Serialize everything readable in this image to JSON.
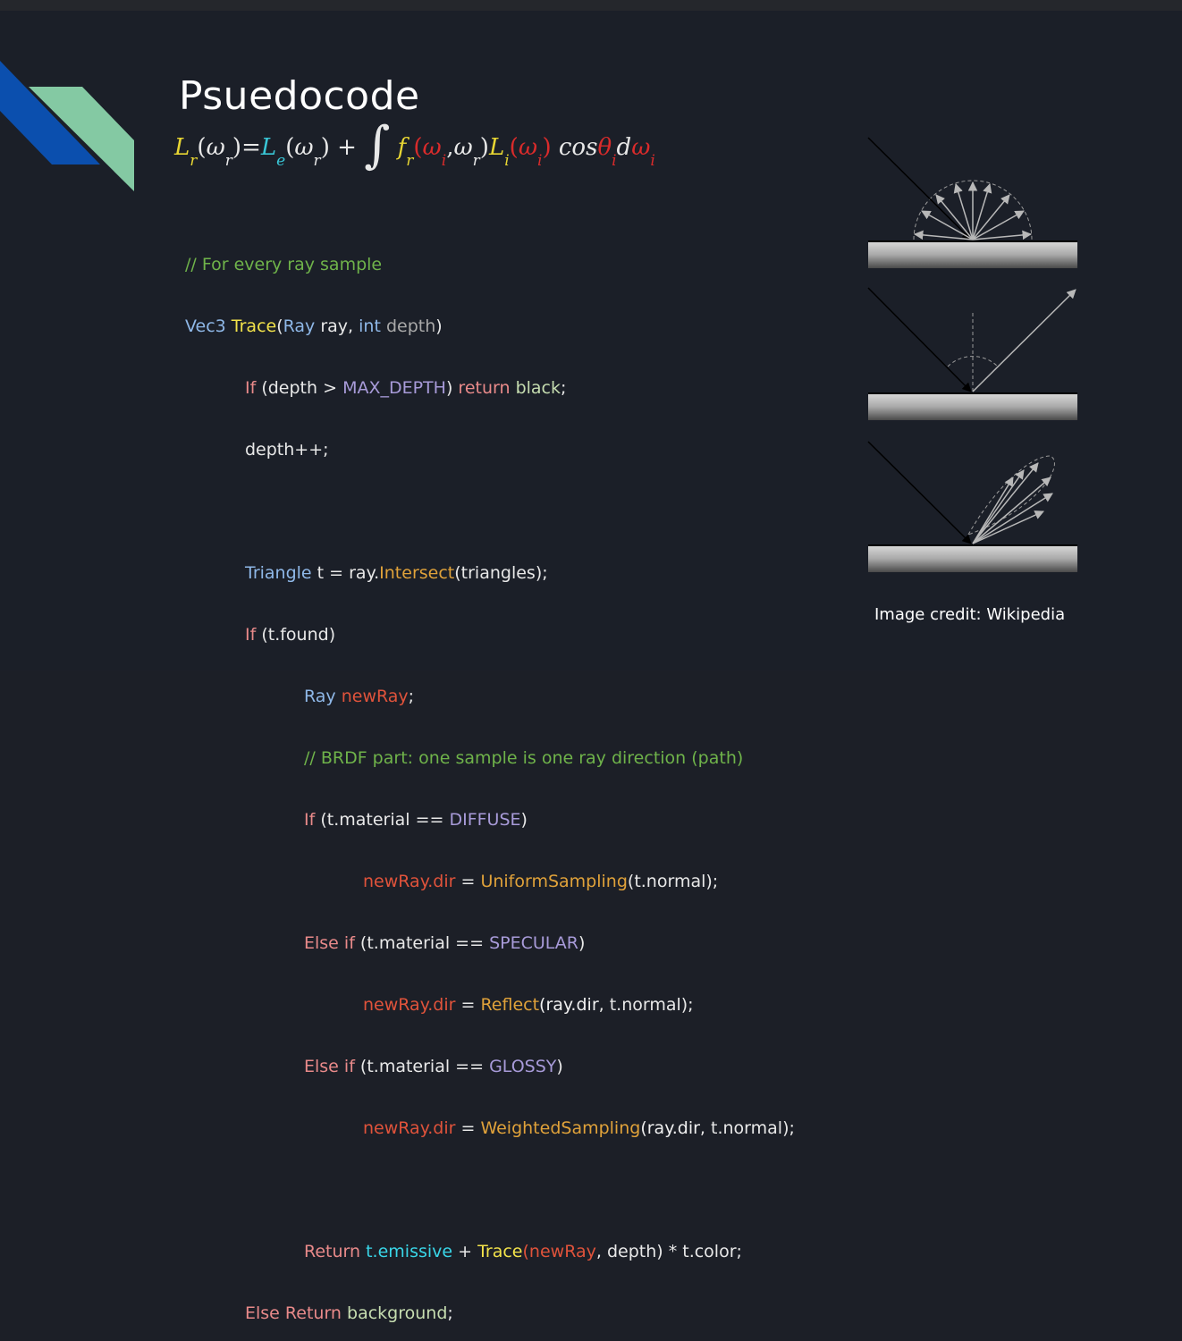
{
  "slide": {
    "title": "Psuedocode",
    "credit": "Image credit: Wikipedia"
  },
  "equation": {
    "L": "L",
    "r": "r",
    "omega": "ω",
    "eq": "=",
    "e": "e",
    "plus": "+",
    "integral": "∫",
    "f": "f",
    "i": "i",
    "comma": ",",
    "cos": "cos",
    "theta": "θ",
    "d": "d",
    "lp": "(",
    "rp": ")"
  },
  "code": {
    "l1": "// For every ray sample",
    "l2": [
      "Vec3",
      " ",
      "Trace",
      "(",
      "Ray",
      " ray, ",
      "int",
      " ",
      "depth",
      ")"
    ],
    "l3": [
      "If",
      " (depth > ",
      "MAX_DEPTH",
      ") ",
      "return",
      " ",
      "black",
      ";"
    ],
    "l4": "depth++;",
    "l6": [
      "Triangle",
      " t = ray.",
      "Intersect",
      "(triangles);"
    ],
    "l7": [
      "If",
      " (t.found)"
    ],
    "l8": [
      "Ray",
      " ",
      "newRay",
      ";"
    ],
    "l9": "// BRDF part: one sample is one ray direction (path)",
    "l10": [
      "If",
      " (t.material == ",
      "DIFFUSE",
      ")"
    ],
    "l11": [
      "newRay.dir",
      " = ",
      "UniformSampling",
      "(t.normal);"
    ],
    "l12": [
      "Else if",
      " (t.material == ",
      "SPECULAR",
      ")"
    ],
    "l13": [
      "newRay.dir",
      " = ",
      "Reflect",
      "(ray.dir",
      ", t.normal);"
    ],
    "l14": [
      "Else if",
      " (t.material == ",
      "GLOSSY",
      ")"
    ],
    "l15": [
      "newRay.dir",
      " = ",
      "WeightedSampling",
      "(ray.dir",
      ", t.normal);"
    ],
    "l17": [
      "Return",
      " ",
      "t.emissive",
      " + ",
      "Trace",
      "(",
      "newRay",
      ", depth) * t.color;"
    ],
    "l18": [
      "Else Return",
      " ",
      "background",
      ";"
    ]
  },
  "colors": {
    "background": "#1b1f28",
    "comment": "#6fb34a",
    "type": "#8fb8e8",
    "function": "#f2e24a",
    "keyword": "#e98a8a",
    "constant": "#a89bd9",
    "variable_red": "#e0533b",
    "method_orange": "#e0a23a",
    "emissive_cyan": "#39d6e8",
    "deco_blue": "#0b4fae",
    "deco_green": "#84c9a3"
  },
  "diagrams": [
    "diffuse-brdf-diagram",
    "specular-brdf-diagram",
    "glossy-brdf-diagram"
  ]
}
